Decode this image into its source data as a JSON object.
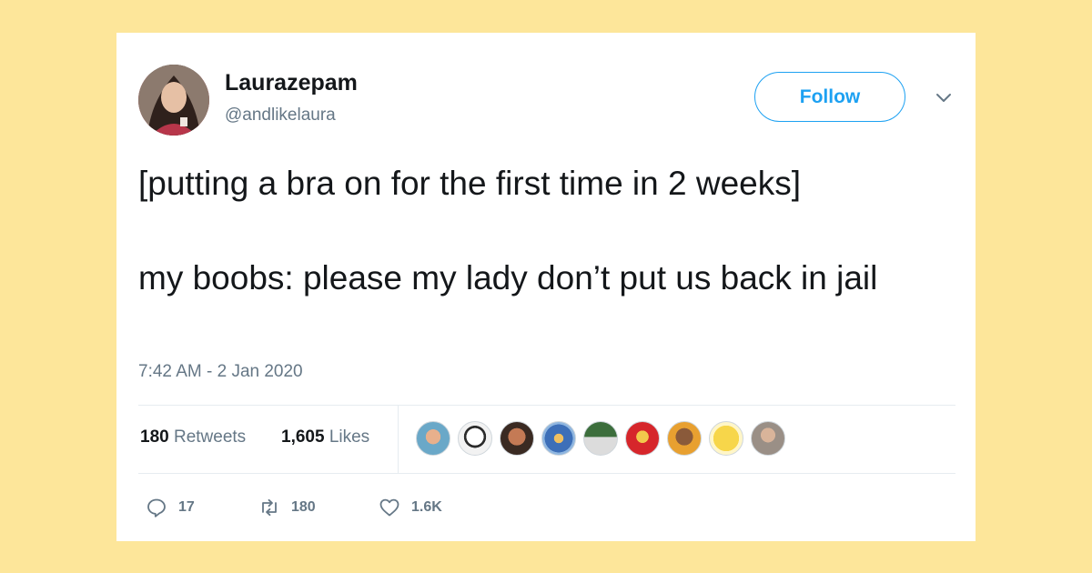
{
  "tweet": {
    "author": {
      "display_name": "Laurazepam",
      "handle": "@andlikelaura",
      "avatar_icon": "user-avatar"
    },
    "follow_label": "Follow",
    "menu_icon": "chevron-down-icon",
    "text_lines": [
      "[putting a bra on for the first time in 2 weeks]",
      "my boobs: please my lady don’t put us back in jail"
    ],
    "timestamp": "7:42 AM - 2 Jan 2020",
    "stats": {
      "retweets_count": "180",
      "retweets_label": "Retweets",
      "likes_count": "1,605",
      "likes_label": "Likes"
    },
    "liked_by_avatars": 9,
    "actions": {
      "reply_count": "17",
      "retweet_count": "180",
      "like_count": "1.6K"
    }
  },
  "colors": {
    "background": "#fde69a",
    "card": "#ffffff",
    "accent": "#1da1f2",
    "secondary_text": "#657786",
    "primary_text": "#14171a"
  }
}
